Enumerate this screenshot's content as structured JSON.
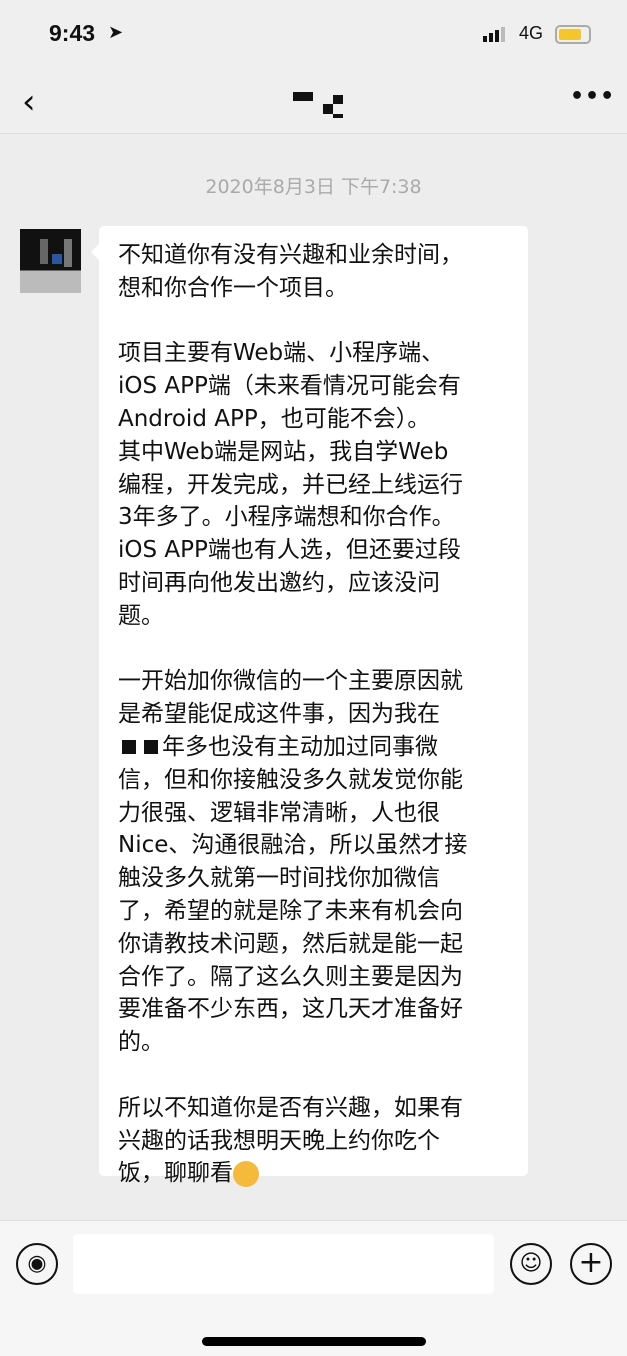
{
  "status_bar": {
    "time": "9:43",
    "location_icon": "location-arrow-icon",
    "network": "4G",
    "battery_color": "#f4c62b"
  },
  "nav": {
    "back_icon": "chevron-left-icon",
    "title": "(redacted)",
    "more_icon": "more-icon"
  },
  "chat": {
    "timestamp": "2020年8月3日 下午7:38",
    "message_lines": [
      [
        "不知道你有没有兴趣和业余时间，",
        "想和你合作一个项目。"
      ],
      [
        "项目主要有Web端、小程序端、",
        "iOS APP端（未来看情况可能会有",
        "Android APP，也可能不会）。",
        "其中Web端是网站，我自学Web",
        "编程，开发完成，并已经上线运行",
        "3年多了。小程序端想和你合作。",
        "iOS APP端也有人选，但还要过段",
        "时间再向他发出邀约，应该没问",
        "题。"
      ],
      [
        "一开始加你微信的一个主要原因就",
        "是希望能促成这件事，因为我在",
        "年多也没有主动加过同事微",
        "信，但和你接触没多久就发觉你能",
        "力很强、逻辑非常清晰，人也很",
        "Nice、沟通很融洽，所以虽然才接",
        "触没多久就第一时间找你加微信",
        "了，希望的就是除了未来有机会向",
        "你请教技术问题，然后就是能一起",
        "合作了。隔了这么久则主要是因为",
        "要准备不少东西，这几天才准备好",
        "的。"
      ],
      [
        "所以不知道你是否有兴趣，如果有",
        "兴趣的话我想明天晚上约你吃个",
        "饭，聊聊看"
      ]
    ]
  },
  "input": {
    "voice_icon": "voice-icon",
    "emoji_icon": "emoji-icon",
    "plus_icon": "plus-icon",
    "value": ""
  }
}
